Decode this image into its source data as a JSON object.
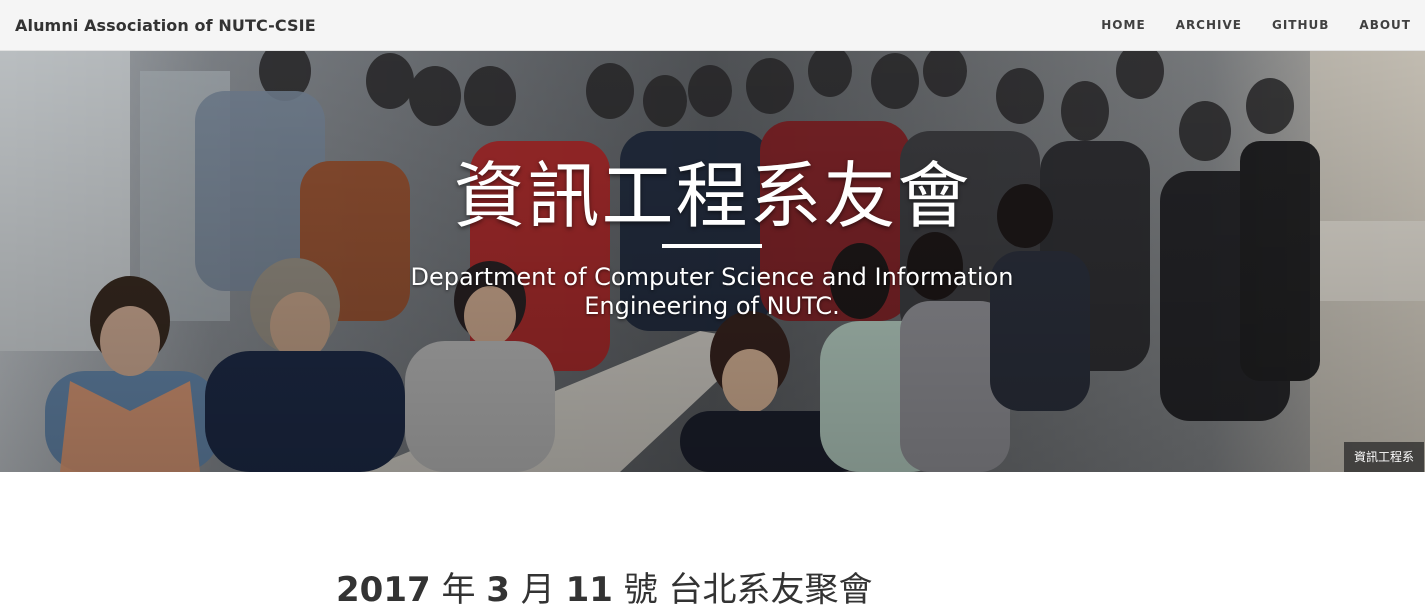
{
  "navbar": {
    "brand": "Alumni Association of NUTC-CSIE",
    "links": [
      "HOME",
      "ARCHIVE",
      "GITHUB",
      "ABOUT"
    ]
  },
  "hero": {
    "title": "資訊工程系友會",
    "subtitle": "Department of Computer Science and Information Engineering of NUTC.",
    "caption": "資訊工程系"
  },
  "post": {
    "title_parts": [
      "2017",
      " 年 ",
      "3",
      " 月 ",
      "11",
      " 號 台北系友聚會"
    ]
  },
  "colors": {
    "navbar_bg": "#f5f5f5",
    "text_dark": "#333333",
    "hero_text": "#ffffff"
  }
}
